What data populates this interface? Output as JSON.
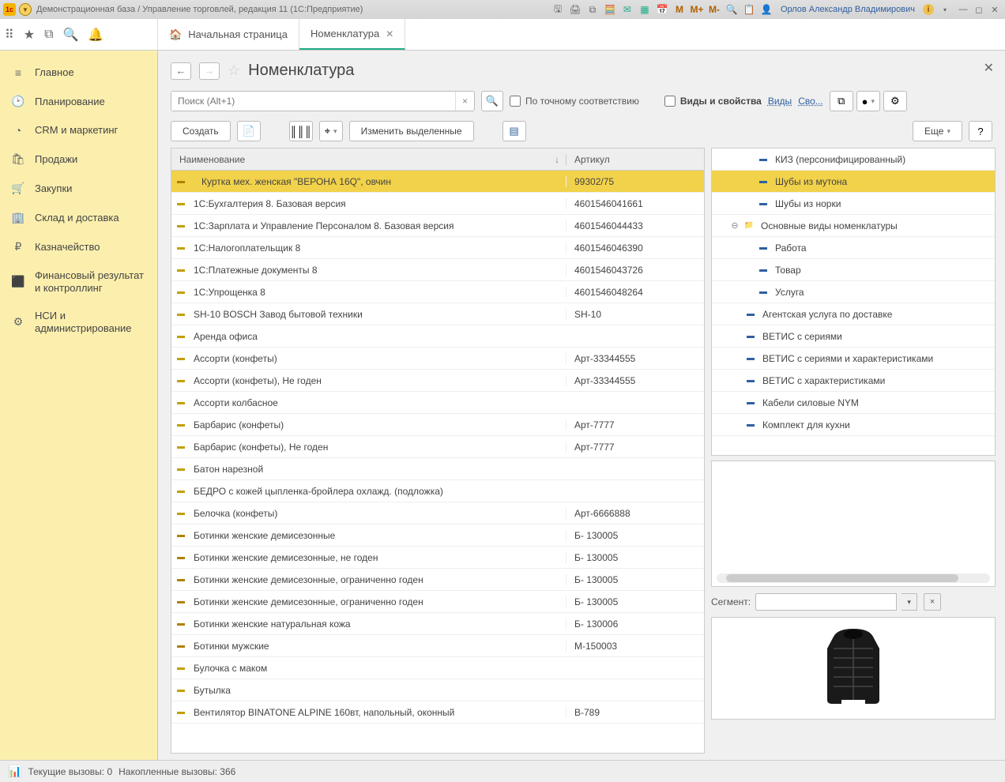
{
  "titlebar": {
    "title": "Демонстрационная база / Управление торговлей, редакция 11  (1С:Предприятие)",
    "user": "Орлов Александр Владимирович",
    "m_icons": [
      "M",
      "M+",
      "M-"
    ]
  },
  "tabs": {
    "home": "Начальная страница",
    "current": "Номенклатура"
  },
  "sidebar": [
    {
      "icon": "≡",
      "label": "Главное"
    },
    {
      "icon": "🕑",
      "label": "Планирование"
    },
    {
      "icon": "◔",
      "label": "CRM и маркетинг"
    },
    {
      "icon": "🛍",
      "label": "Продажи"
    },
    {
      "icon": "🛒",
      "label": "Закупки"
    },
    {
      "icon": "🏢",
      "label": "Склад и доставка"
    },
    {
      "icon": "₽",
      "label": "Казначейство"
    },
    {
      "icon": "⬛",
      "label": "Финансовый результат и контроллинг"
    },
    {
      "icon": "⚙",
      "label": "НСИ и администрирование"
    }
  ],
  "page": {
    "title": "Номенклатура",
    "search_placeholder": "Поиск (Alt+1)",
    "exact_match": "По точному соответствию",
    "views_props": "Виды и свойства",
    "link_views": "Виды",
    "link_props": "Сво...",
    "btn_create": "Создать",
    "btn_edit": "Изменить выделенные",
    "btn_more": "Еще",
    "segment_label": "Сегмент:"
  },
  "columns": {
    "name": "Наименование",
    "article": "Артикул",
    "sort": "↓"
  },
  "rows": [
    {
      "ic": "yk",
      "name": "Куртка мех. женская \"ВЕРОНА 16Q\", овчин",
      "art": "99302/75",
      "sel": true,
      "indent": true
    },
    {
      "ic": "y",
      "name": "1С:Бухгалтерия 8. Базовая версия",
      "art": "4601546041661"
    },
    {
      "ic": "y",
      "name": "1С:Зарплата и Управление Персоналом 8. Базовая версия",
      "art": "4601546044433"
    },
    {
      "ic": "y",
      "name": "1С:Налогоплательщик 8",
      "art": "4601546046390"
    },
    {
      "ic": "y",
      "name": "1С:Платежные документы 8",
      "art": "4601546043726"
    },
    {
      "ic": "y",
      "name": "1С:Упрощенка 8",
      "art": "4601546048264"
    },
    {
      "ic": "y",
      "name": "SH-10 BOSCH Завод бытовой техники",
      "art": "SH-10"
    },
    {
      "ic": "y",
      "name": "Аренда офиса",
      "art": ""
    },
    {
      "ic": "y",
      "name": "Ассорти (конфеты)",
      "art": "Арт-33344555"
    },
    {
      "ic": "y",
      "name": "Ассорти (конфеты), Не годен",
      "art": "Арт-33344555"
    },
    {
      "ic": "y",
      "name": "Ассорти колбасное",
      "art": ""
    },
    {
      "ic": "y",
      "name": "Барбарис (конфеты)",
      "art": "Арт-7777"
    },
    {
      "ic": "y",
      "name": "Барбарис (конфеты), Не годен",
      "art": "Арт-7777"
    },
    {
      "ic": "y",
      "name": "Батон нарезной",
      "art": ""
    },
    {
      "ic": "y",
      "name": "БЕДРО с кожей цыпленка-бройлера охлажд. (подложка)",
      "art": ""
    },
    {
      "ic": "y",
      "name": "Белочка (конфеты)",
      "art": "Арт-6666888"
    },
    {
      "ic": "yk",
      "name": "Ботинки женские демисезонные",
      "art": "Б- 130005"
    },
    {
      "ic": "yk",
      "name": "Ботинки женские демисезонные, не годен",
      "art": "Б- 130005"
    },
    {
      "ic": "yk",
      "name": "Ботинки женские демисезонные, ограниченно годен",
      "art": "Б- 130005"
    },
    {
      "ic": "yk",
      "name": "Ботинки женские демисезонные, ограниченно годен",
      "art": "Б- 130005"
    },
    {
      "ic": "yk",
      "name": "Ботинки женские натуральная кожа",
      "art": "Б- 130006"
    },
    {
      "ic": "yk",
      "name": "Ботинки мужские",
      "art": "М-150003"
    },
    {
      "ic": "y",
      "name": "Булочка с маком",
      "art": ""
    },
    {
      "ic": "y",
      "name": "Бутылка",
      "art": ""
    },
    {
      "ic": "y",
      "name": "Вентилятор BINATONE ALPINE 160вт, напольный, оконный",
      "art": "В-789"
    }
  ],
  "tree": [
    {
      "ind": 56,
      "ic": "-",
      "label": "КИЗ (персонифицированный)"
    },
    {
      "ind": 56,
      "ic": "-",
      "label": "Шубы из мутона",
      "sel": true
    },
    {
      "ind": 56,
      "ic": "-",
      "label": "Шубы из норки"
    },
    {
      "ind": 20,
      "ic": "fld",
      "label": "Основные виды номенклатуры",
      "minus": true
    },
    {
      "ind": 56,
      "ic": "-",
      "label": "Работа"
    },
    {
      "ind": 56,
      "ic": "-",
      "label": "Товар"
    },
    {
      "ind": 56,
      "ic": "-",
      "label": "Услуга"
    },
    {
      "ind": 40,
      "ic": "-",
      "label": "Агентская услуга по доставке"
    },
    {
      "ind": 40,
      "ic": "-",
      "label": "ВЕТИС с сериями"
    },
    {
      "ind": 40,
      "ic": "-",
      "label": "ВЕТИС с сериями и характеристиками"
    },
    {
      "ind": 40,
      "ic": "-",
      "label": "ВЕТИС с характеристиками"
    },
    {
      "ind": 40,
      "ic": "-",
      "label": "Кабели силовые NYM"
    },
    {
      "ind": 40,
      "ic": "-",
      "label": "Комплект для кухни"
    }
  ],
  "status": {
    "current": "Текущие вызовы:  0",
    "accum": "Накопленные вызовы:  366"
  }
}
